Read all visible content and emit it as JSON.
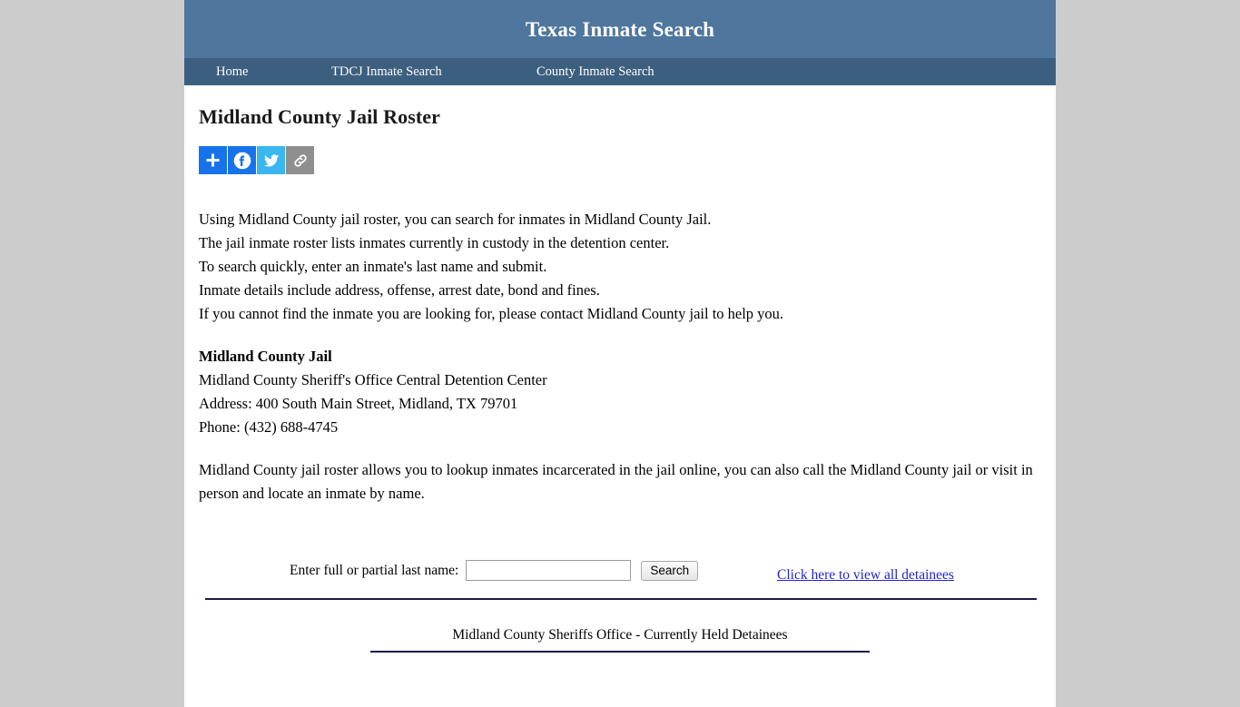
{
  "site": {
    "title": "Texas Inmate Search",
    "header_bg": "#4f769c",
    "nav_bg": "#3d5f7f",
    "page_bg": "#ffffff",
    "outer_bg": "#cccccc"
  },
  "nav": {
    "items": [
      {
        "label": "Home",
        "name": "nav-home"
      },
      {
        "label": "TDCJ Inmate Search",
        "name": "nav-tdcj"
      },
      {
        "label": "County Inmate Search",
        "name": "nav-county"
      }
    ]
  },
  "page": {
    "heading": "Midland County Jail Roster"
  },
  "share": {
    "buttons": [
      {
        "icon": "plus-icon",
        "label": "Share",
        "color": "#1773ea"
      },
      {
        "icon": "facebook-icon",
        "label": "Facebook",
        "color": "#1773ea"
      },
      {
        "icon": "twitter-icon",
        "label": "Twitter",
        "color": "#3ab6f1"
      },
      {
        "icon": "link-icon",
        "label": "Copy Link",
        "color": "#8f8f8f"
      }
    ]
  },
  "intro": {
    "lines": [
      "Using Midland County jail roster, you can search for inmates in Midland County Jail.",
      "The jail inmate roster lists inmates currently in custody in the detention center.",
      "To search quickly, enter an inmate's last name and submit.",
      "Inmate details include address, offense, arrest date, bond and fines.",
      "If you cannot find the inmate you are looking for, please contact Midland County jail to help you."
    ]
  },
  "jail": {
    "name": "Midland County Jail",
    "office": "Midland County Sheriff's Office Central Detention Center",
    "address": "Address: 400 South Main Street, Midland, TX 79701",
    "phone": "Phone: (432) 688-4745"
  },
  "closing": {
    "text": "Midland County jail roster allows you to lookup inmates incarcerated in the jail online, you can also call the Midland County jail or visit in person and locate an inmate by name."
  },
  "search": {
    "label": "Enter full or partial last name:",
    "input_value": "",
    "input_placeholder": "",
    "button_label": "Search",
    "view_all_label": "Click here to view all detainees",
    "link_color": "#2424cf"
  },
  "roster": {
    "heading": "Midland County Sheriffs Office - Currently Held Detainees",
    "rule_color": "#1a1a4e"
  }
}
